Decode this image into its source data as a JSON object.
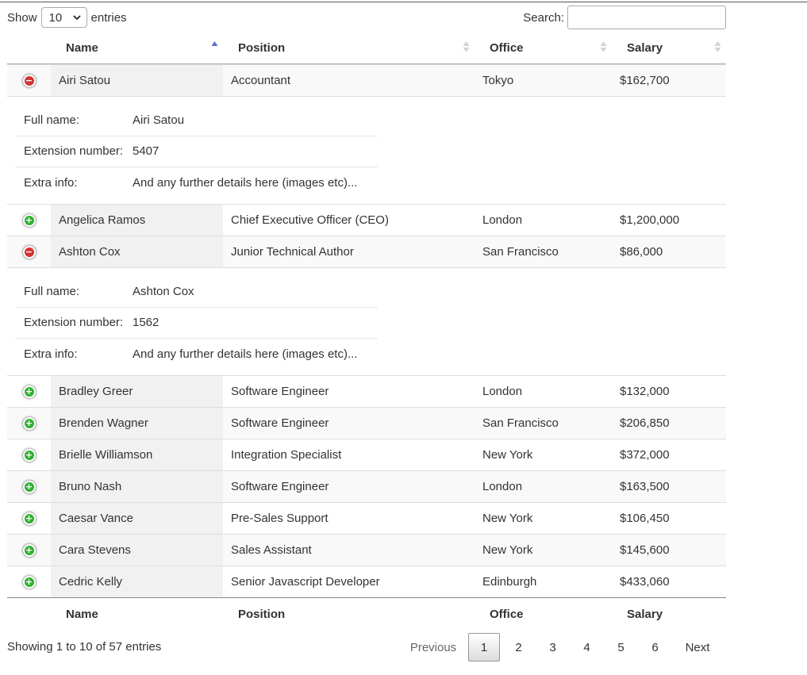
{
  "controls": {
    "show_label": "Show",
    "length_value": "10",
    "entries_label": "entries",
    "search_label": "Search:",
    "search_value": ""
  },
  "columns": [
    "Name",
    "Position",
    "Office",
    "Salary"
  ],
  "sort": {
    "column": "Name",
    "direction": "ascending"
  },
  "rows": [
    {
      "name": "Airi Satou",
      "position": "Accountant",
      "office": "Tokyo",
      "salary": "$162,700",
      "expanded": true,
      "details": {
        "full_name_label": "Full name:",
        "full_name": "Airi Satou",
        "extension_label": "Extension number:",
        "extension": "5407",
        "extra_label": "Extra info:",
        "extra": "And any further details here (images etc)..."
      }
    },
    {
      "name": "Angelica Ramos",
      "position": "Chief Executive Officer (CEO)",
      "office": "London",
      "salary": "$1,200,000",
      "expanded": false
    },
    {
      "name": "Ashton Cox",
      "position": "Junior Technical Author",
      "office": "San Francisco",
      "salary": "$86,000",
      "expanded": true,
      "details": {
        "full_name_label": "Full name:",
        "full_name": "Ashton Cox",
        "extension_label": "Extension number:",
        "extension": "1562",
        "extra_label": "Extra info:",
        "extra": "And any further details here (images etc)..."
      }
    },
    {
      "name": "Bradley Greer",
      "position": "Software Engineer",
      "office": "London",
      "salary": "$132,000",
      "expanded": false
    },
    {
      "name": "Brenden Wagner",
      "position": "Software Engineer",
      "office": "San Francisco",
      "salary": "$206,850",
      "expanded": false
    },
    {
      "name": "Brielle Williamson",
      "position": "Integration Specialist",
      "office": "New York",
      "salary": "$372,000",
      "expanded": false
    },
    {
      "name": "Bruno Nash",
      "position": "Software Engineer",
      "office": "London",
      "salary": "$163,500",
      "expanded": false
    },
    {
      "name": "Caesar Vance",
      "position": "Pre-Sales Support",
      "office": "New York",
      "salary": "$106,450",
      "expanded": false
    },
    {
      "name": "Cara Stevens",
      "position": "Sales Assistant",
      "office": "New York",
      "salary": "$145,600",
      "expanded": false
    },
    {
      "name": "Cedric Kelly",
      "position": "Senior Javascript Developer",
      "office": "Edinburgh",
      "salary": "$433,060",
      "expanded": false
    }
  ],
  "info": "Showing 1 to 10 of 57 entries",
  "pagination": {
    "previous": "Previous",
    "pages": [
      "1",
      "2",
      "3",
      "4",
      "5",
      "6"
    ],
    "current": "1",
    "next": "Next"
  },
  "colors": {
    "open_control": "#d33333",
    "closed_control": "#31b131",
    "sort_active": "#6272c8"
  }
}
